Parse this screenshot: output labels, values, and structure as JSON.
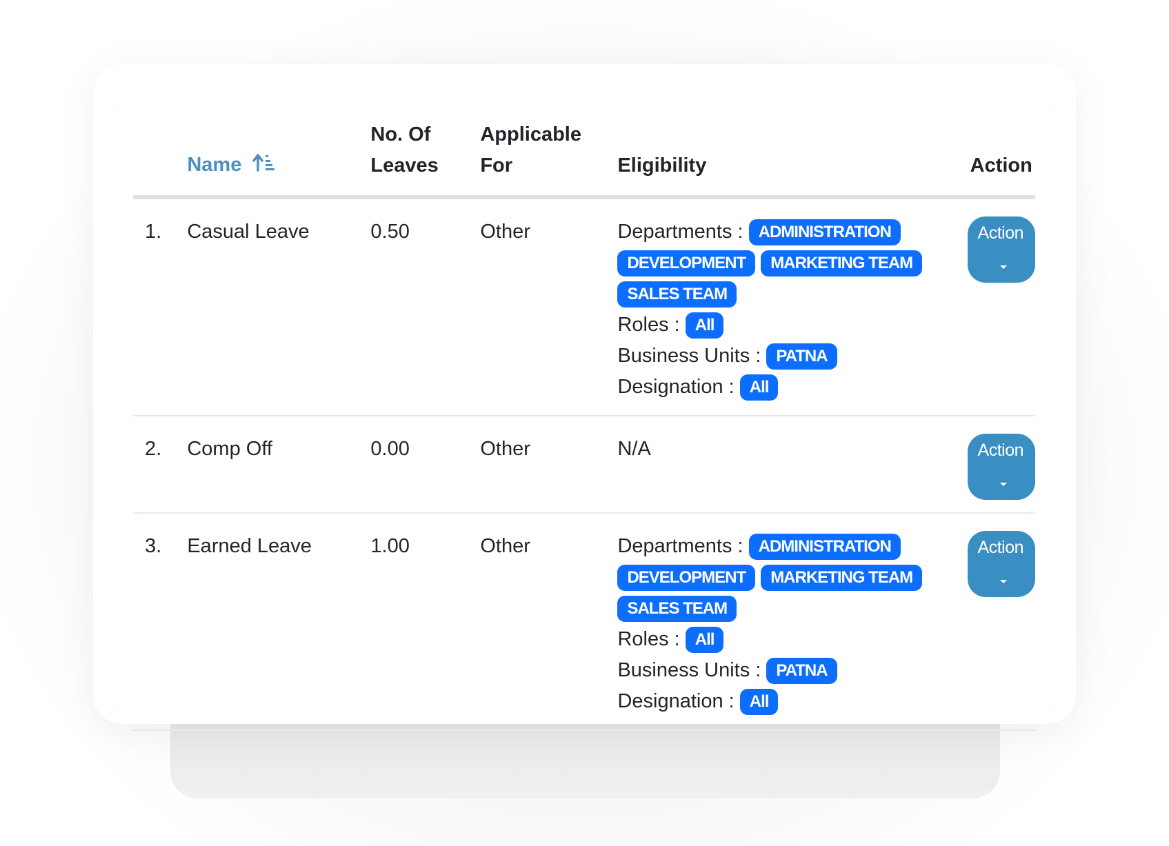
{
  "table": {
    "headers": {
      "index": "",
      "name": "Name",
      "leaves_line1": "No. Of",
      "leaves_line2": "Leaves",
      "applicable_line1": "Applicable",
      "applicable_line2": "For",
      "eligibility": "Eligibility",
      "action": "Action"
    },
    "sort_icon": "sort-ascending-icon",
    "rows": [
      {
        "index": "1.",
        "name": "Casual Leave",
        "leaves": "0.50",
        "applicable_for": "Other",
        "eligibility": {
          "departments_label": "Departments :",
          "departments": [
            "ADMINISTRATION",
            "DEVELOPMENT",
            "MARKETING TEAM",
            "SALES TEAM"
          ],
          "roles_label": "Roles :",
          "roles": [
            "All"
          ],
          "business_units_label": "Business Units :",
          "business_units": [
            "PATNA"
          ],
          "designation_label": "Designation :",
          "designation": [
            "All"
          ]
        },
        "action_label": "Action"
      },
      {
        "index": "2.",
        "name": "Comp Off",
        "leaves": "0.00",
        "applicable_for": "Other",
        "eligibility_text": "N/A",
        "action_label": "Action"
      },
      {
        "index": "3.",
        "name": "Earned Leave",
        "leaves": "1.00",
        "applicable_for": "Other",
        "eligibility": {
          "departments_label": "Departments :",
          "departments": [
            "ADMINISTRATION",
            "DEVELOPMENT",
            "MARKETING TEAM",
            "SALES TEAM"
          ],
          "roles_label": "Roles :",
          "roles": [
            "All"
          ],
          "business_units_label": "Business Units :",
          "business_units": [
            "PATNA"
          ],
          "designation_label": "Designation :",
          "designation": [
            "All"
          ]
        },
        "action_label": "Action"
      }
    ]
  },
  "colors": {
    "badge": "#0d6efd",
    "action_button": "#3a8fc2",
    "sort_header": "#4a90c2"
  }
}
